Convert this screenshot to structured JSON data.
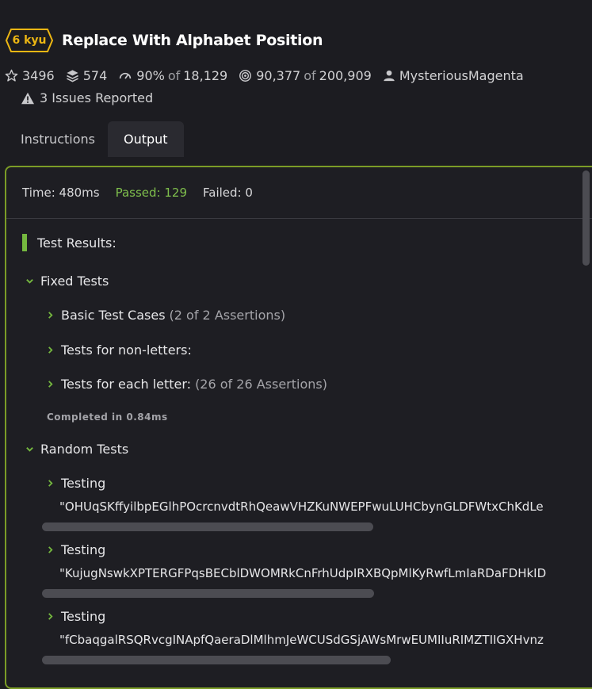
{
  "kata": {
    "kyu_label": "6 kyu",
    "title": "Replace With Alphabet Position",
    "kyu_color": "#ecb613"
  },
  "stats": {
    "stars": "3496",
    "collections": "574",
    "satisfaction": "90%",
    "of_word": "of",
    "votes": "18,129",
    "completed": "90,377",
    "attempts": "200,909",
    "author": "MysteriousMagenta"
  },
  "issues": {
    "label": "3 Issues Reported"
  },
  "tabs": [
    {
      "label": "Instructions",
      "active": false
    },
    {
      "label": "Output",
      "active": true
    }
  ],
  "output": {
    "time": "Time: 480ms",
    "passed": "Passed: 129",
    "failed": "Failed: 0",
    "results_title": "Test Results:",
    "accent": "#7b9c26",
    "fixed": {
      "label": "Fixed Tests",
      "items": [
        {
          "label": "Basic Test Cases",
          "assertions": "(2 of 2 Assertions)"
        },
        {
          "label": "Tests for non-letters:",
          "assertions": ""
        },
        {
          "label": "Tests for each letter:",
          "assertions": "(26 of 26 Assertions)"
        }
      ],
      "completed": "Completed in 0.84ms"
    },
    "random": {
      "label": "Random Tests",
      "items": [
        {
          "label": "Testing",
          "value": "\"OHUqSKffyilbpEGlhPOcrcnvdtRhQeawVHZKuNWEPFwuLUHCbynGLDFWtxChKdLe"
        },
        {
          "label": "Testing",
          "value": "\"KujugNswkXPTERGFPqsBECblDWOMRkCnFrhUdpIRXBQpMlKyRwfLmIaRDaFDHkID"
        },
        {
          "label": "Testing",
          "value": "\"fCbaqgalRSQRvcgINApfQaeraDlMlhmJeWCUSdGSjAWsMrwEUMIIuRIMZTIIGXHvnz"
        }
      ]
    }
  }
}
